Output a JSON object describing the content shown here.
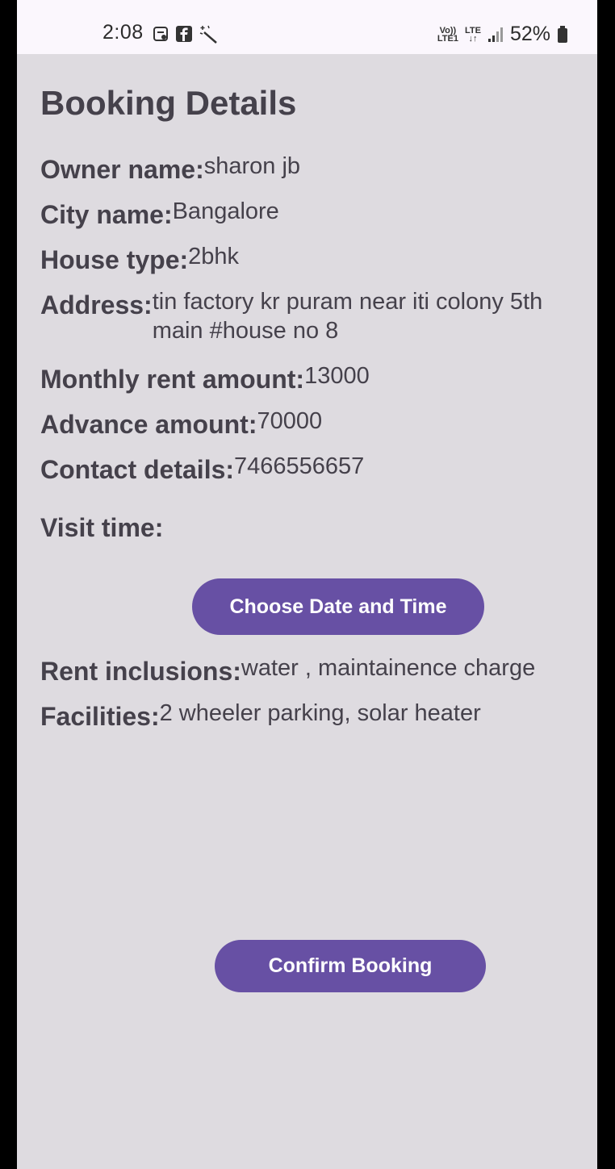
{
  "status_bar": {
    "time": "2:08",
    "network_top": "Vo))",
    "network_bottom": "LTE1",
    "lte": "LTE",
    "battery": "52%"
  },
  "page": {
    "title": "Booking Details"
  },
  "fields": {
    "owner": {
      "label": "Owner name:",
      "value": "sharon jb"
    },
    "city": {
      "label": "City name:",
      "value": "Bangalore"
    },
    "house_type": {
      "label": "House type:",
      "value": "2bhk"
    },
    "address": {
      "label": "Address:",
      "value": "tin factory kr puram near iti colony 5th main #house no 8"
    },
    "monthly_rent": {
      "label": "Monthly rent amount:",
      "value": "13000"
    },
    "advance": {
      "label": "Advance amount:",
      "value": "70000"
    },
    "contact": {
      "label": "Contact details:",
      "value": "7466556657"
    },
    "visit_time": {
      "label": "Visit time:",
      "value": ""
    },
    "rent_inclusions": {
      "label": "Rent inclusions:",
      "value": "water , maintainence charge"
    },
    "facilities": {
      "label": "Facilities:",
      "value": "2 wheeler parking, solar heater"
    }
  },
  "buttons": {
    "choose_datetime": "Choose Date and Time",
    "confirm_booking": "Confirm Booking"
  },
  "colors": {
    "background": "#dedbe0",
    "status_bar": "#fbf7fd",
    "text": "#45414b",
    "button": "#6750a4",
    "button_text": "#ffffff"
  }
}
